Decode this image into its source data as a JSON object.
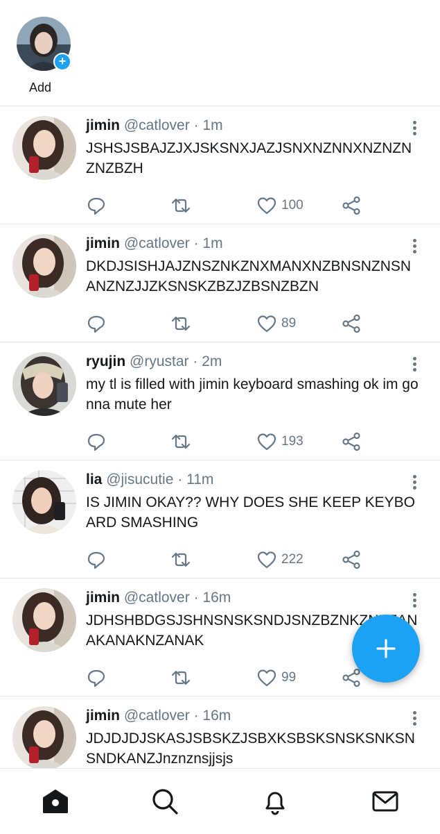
{
  "fleets": {
    "add_label": "Add"
  },
  "tweets": [
    {
      "name": "jimin",
      "handle": "@catlover",
      "time": "1m",
      "text": "JSHSJSBAJZJXJSKSNXJAZJSNXNZNNXNZNZNZNZBZH",
      "likes": "100",
      "avatar": "jimin"
    },
    {
      "name": "jimin",
      "handle": "@catlover",
      "time": "1m",
      "text": "DKDJSISHJAJZNSZNKZNXMANXNZBNSNZNSNANZNZJJZKSNSKZBZJZBSNZBZN",
      "likes": "89",
      "avatar": "jimin"
    },
    {
      "name": "ryujin",
      "handle": "@ryustar",
      "time": "2m",
      "text": "my tl is filled with jimin keyboard smashing ok im gonna mute her",
      "likes": "193",
      "avatar": "ryujin"
    },
    {
      "name": "lia",
      "handle": "@jisucutie",
      "time": "11m",
      "text": "IS JIMIN OKAY?? WHY DOES SHE KEEP KEYBOARD SMASHING",
      "likes": "222",
      "avatar": "lia"
    },
    {
      "name": "jimin",
      "handle": "@catlover",
      "time": "16m",
      "text": "JDHSHBDGSJSHNSNSKSNDJSNZBZNKZNKZANAKANAKNZANAK",
      "likes": "99",
      "avatar": "jimin"
    },
    {
      "name": "jimin",
      "handle": "@catlover",
      "time": "16m",
      "text": "JDJDJDJSKASJSBSKZJSBXKSBSKSNSKSNKSNSNDKANZJnznznsjjsjs",
      "likes": "",
      "avatar": "jimin"
    }
  ],
  "separator": "·",
  "icons": {
    "reply": "reply-icon",
    "retweet": "retweet-icon",
    "like": "heart-icon",
    "share": "share-icon",
    "more": "more-vertical-icon",
    "compose": "plus-icon",
    "nav": [
      "home-icon",
      "search-icon",
      "bell-icon",
      "mail-icon"
    ]
  },
  "colors": {
    "accent": "#1da1f2",
    "muted": "#657786",
    "text": "#14171a",
    "divider": "#e1e8ed"
  }
}
